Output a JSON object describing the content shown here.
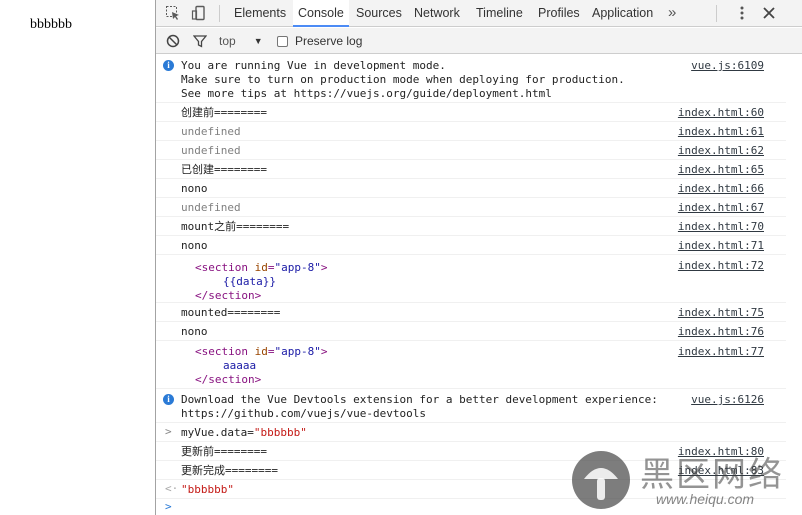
{
  "page": {
    "text": "bbbbbb"
  },
  "toolbar": {
    "tabs": [
      "Elements",
      "Console",
      "Sources",
      "Network",
      "Timeline",
      "Profiles",
      "Application"
    ],
    "active_tab": "Console",
    "more": "»"
  },
  "filter": {
    "context": "top",
    "preserve_label": "Preserve log",
    "preserve_checked": false
  },
  "console": {
    "info1": {
      "lines": [
        "You are running Vue in development mode.",
        "Make sure to turn on production mode when deploying for production.",
        "See more tips at https://vuejs.org/guide/deployment.html"
      ],
      "source": "vue.js:6109"
    },
    "rows": [
      {
        "text": "创建前========",
        "source": "index.html:60"
      },
      {
        "text": "undefined",
        "source": "index.html:61"
      },
      {
        "text": "undefined",
        "source": "index.html:62"
      },
      {
        "text": "已创建========",
        "source": "index.html:65"
      },
      {
        "text": "nono",
        "source": "index.html:66"
      },
      {
        "text": "undefined",
        "source": "index.html:67"
      },
      {
        "text": "mount之前========",
        "source": "index.html:70"
      },
      {
        "text": "nono",
        "source": "index.html:71"
      }
    ],
    "element1": {
      "open_tag": "section",
      "attr_name": "id",
      "attr_value": "\"app-8\"",
      "content": "{{data}}",
      "close_tag": "</section>",
      "source": "index.html:72"
    },
    "rows2": [
      {
        "text": "mounted========",
        "source": "index.html:75"
      },
      {
        "text": "nono",
        "source": "index.html:76"
      }
    ],
    "element2": {
      "open_tag": "section",
      "attr_name": "id",
      "attr_value": "\"app-8\"",
      "content": "aaaaa",
      "close_tag": "</section>",
      "source": "index.html:77"
    },
    "info2": {
      "lines": [
        "Download the Vue Devtools extension for a better development experience:",
        "https://github.com/vuejs/vue-devtools"
      ],
      "source": "vue.js:6126"
    },
    "input_cmd": "myVue.data=",
    "input_str": "\"bbbbbb\"",
    "rows3": [
      {
        "text": "更新前========",
        "source": "index.html:80"
      },
      {
        "text": "更新完成========",
        "source": "index.html:83"
      }
    ],
    "result": "\"bbbbbb\"",
    "prompt": ">"
  },
  "watermark": {
    "cn": "黑区网络",
    "url": "www.heiqu.com"
  },
  "colors": {
    "accent": "#4c8bf5",
    "info": "#2a7ad6",
    "tag": "#881280",
    "attr": "#994500",
    "string": "#c41a16"
  }
}
